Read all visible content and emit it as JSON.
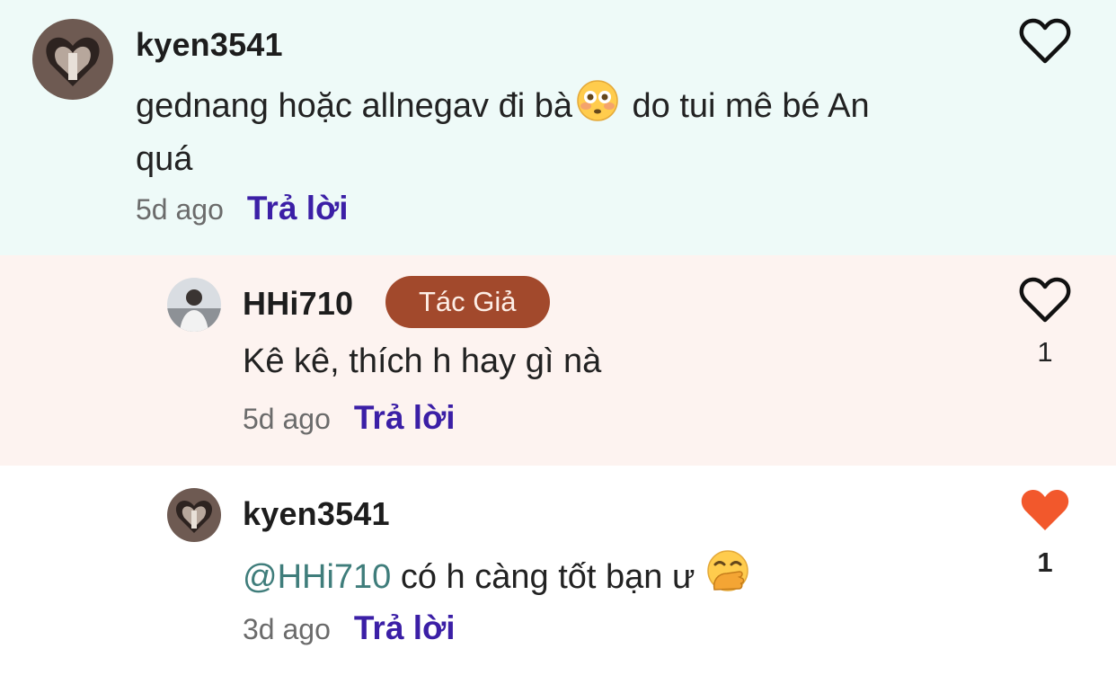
{
  "comments": [
    {
      "username": "kyen3541",
      "text_before": "gednang hoặc allnegav đi bà",
      "emoji": "flushed-face-emoji",
      "text_after": " do tui mê bé An",
      "text_line2": "quá",
      "time": "5d ago",
      "reply_label": "Trả lời",
      "liked": false
    },
    {
      "username": "HHi710",
      "badge": "Tác Giả",
      "text": "Kê kê, thích h hay gì nà",
      "time": "5d ago",
      "reply_label": "Trả lời",
      "like_count": "1",
      "liked": false
    },
    {
      "username": "kyen3541",
      "mention": "@HHi710",
      "text": " có h càng tốt bạn ư",
      "emoji": "hand-over-mouth-emoji",
      "time": "3d ago",
      "reply_label": "Trả lời",
      "like_count": "1",
      "liked": true
    }
  ],
  "colors": {
    "reply_link": "#3b1fa6",
    "badge_bg": "#a2492c",
    "liked_heart": "#f2582c",
    "mention": "#3f7d7b",
    "comment1_bg": "#eefaf8",
    "comment2_bg": "#fdf3f0"
  }
}
